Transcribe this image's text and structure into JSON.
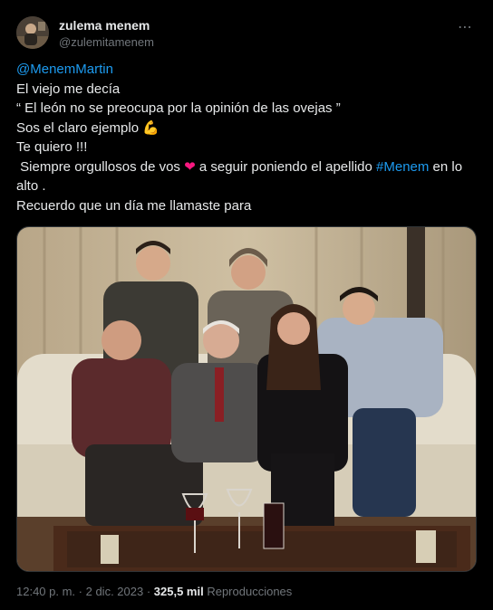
{
  "author": {
    "name": "zulema menem",
    "handle": "@zulemitamenem",
    "avatar_icon": "avatar-photo"
  },
  "more_icon": "⋯",
  "tweet": {
    "mention": "@MenemMartin",
    "line1": "El viejo me decía",
    "line2": "“ El león no se preocupa por la opinión de las ovejas ”",
    "line3": "Sos el claro ejemplo ",
    "line3_emoji": "💪",
    "line4": "Te quiero !!!",
    "line5_a": " Siempre orgullosos de vos ",
    "line5_heart": "❤",
    "line5_b": " a seguir poniendo el apellido ",
    "line5_hashtag": "#Menem",
    "line5_c": " en lo alto .",
    "line6": "Recuerdo que un día me llamaste para"
  },
  "meta": {
    "time": "12:40 p. m.",
    "sep": " · ",
    "date": "2 dic. 2023",
    "sep2": " · ",
    "views": "325,5 mil",
    "views_label": " Reproducciones"
  },
  "colors": {
    "background": "#000000",
    "link": "#1d9bf0",
    "muted": "#71767b",
    "heart": "#f91880"
  }
}
